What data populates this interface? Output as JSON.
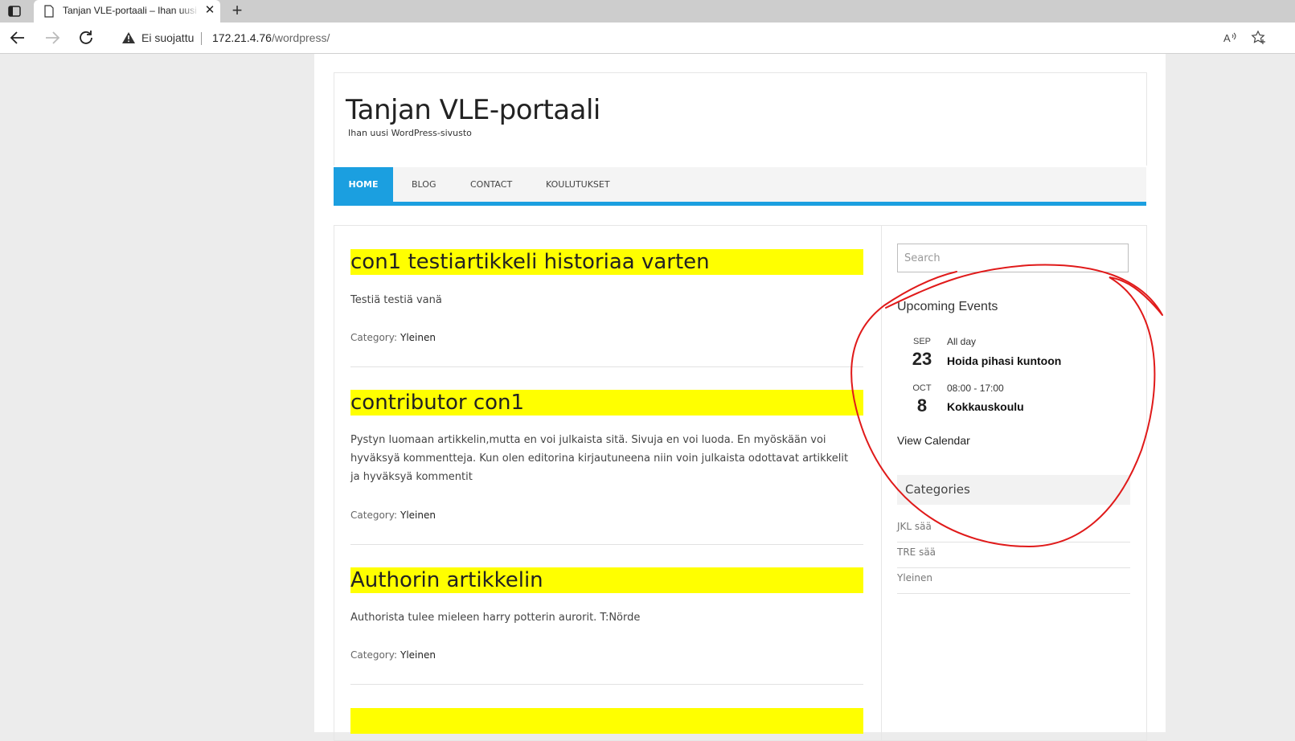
{
  "browser": {
    "tab_title": "Tanjan VLE-portaali – Ihan uusi WordPress-sivusto",
    "tab_close": "✕",
    "new_tab": "+",
    "security_label": "Ei suojattu",
    "url_host": "172.21.4.76",
    "url_path": "/wordpress/"
  },
  "site": {
    "title": "Tanjan VLE-portaali",
    "description": "Ihan uusi WordPress-sivusto"
  },
  "menu": {
    "items": [
      {
        "label": "Home"
      },
      {
        "label": "Blog"
      },
      {
        "label": "Contact"
      },
      {
        "label": "Koulutukset"
      }
    ]
  },
  "posts": [
    {
      "title": "con1 testiartikkeli historiaa varten",
      "excerpt": "Testiä testiä vanä",
      "category_label": "Category:",
      "category": "Yleinen"
    },
    {
      "title": "contributor con1",
      "excerpt": "Pystyn luomaan artikkelin,mutta en voi julkaista sitä. Sivuja en voi luoda. En myöskään voi hyväksyä kommentteja. Kun olen editorina kirjautuneena niin voin julkaista odottavat artikkelit ja hyväksyä kommentit",
      "category_label": "Category:",
      "category": "Yleinen"
    },
    {
      "title": "Authorin artikkelin",
      "excerpt": "Authorista tulee mieleen harry potterin aurorit. T:Nörde",
      "category_label": "Category:",
      "category": "Yleinen"
    },
    {
      "title": "",
      "excerpt": "",
      "category_label": "",
      "category": ""
    }
  ],
  "sidebar": {
    "search_placeholder": "Search",
    "events_title": "Upcoming Events",
    "events": [
      {
        "month": "SEP",
        "day": "23",
        "time": "All day",
        "name": "Hoida pihasi kuntoon"
      },
      {
        "month": "OCT",
        "day": "8",
        "time": "08:00 - 17:00",
        "name": "Kokkauskoulu"
      }
    ],
    "view_calendar": "View Calendar",
    "categories_title": "Categories",
    "categories": [
      "JKL sää",
      "TRE sää",
      "Yleinen"
    ]
  },
  "colors": {
    "accent": "#1b9fe0",
    "post_title_highlight": "#ffff00",
    "annotation": "#e01a1a"
  },
  "icons": [
    "sidebar-toggle-icon",
    "page-icon",
    "close-icon",
    "plus-icon",
    "back-arrow-icon",
    "forward-arrow-icon",
    "reload-icon",
    "warning-icon",
    "read-aloud-icon",
    "favorite-star-icon"
  ]
}
